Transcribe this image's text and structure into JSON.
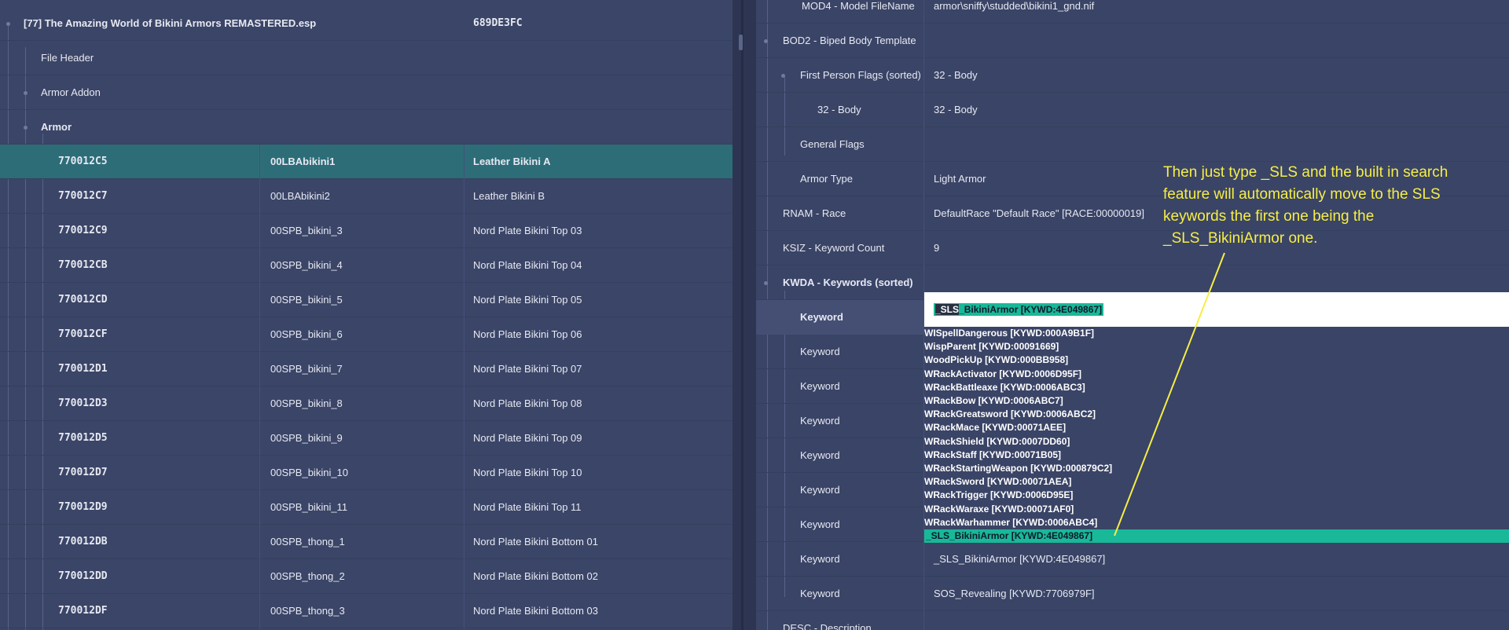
{
  "left_panel": {
    "plugin": {
      "label": "[77] The Amazing World of Bikini Armors REMASTERED.esp",
      "formid_prefix": "689DE3FC"
    },
    "groups": [
      {
        "label": "File Header"
      },
      {
        "label": "Armor Addon"
      },
      {
        "label": "Armor"
      }
    ],
    "records": [
      {
        "formid": "770012C5",
        "editor_id": "00LBAbikini1",
        "name": "Leather Bikini A",
        "selected": true
      },
      {
        "formid": "770012C7",
        "editor_id": "00LBAbikini2",
        "name": "Leather Bikini B"
      },
      {
        "formid": "770012C9",
        "editor_id": "00SPB_bikini_3",
        "name": "Nord Plate Bikini Top 03"
      },
      {
        "formid": "770012CB",
        "editor_id": "00SPB_bikini_4",
        "name": "Nord Plate Bikini Top 04"
      },
      {
        "formid": "770012CD",
        "editor_id": "00SPB_bikini_5",
        "name": "Nord Plate Bikini Top 05"
      },
      {
        "formid": "770012CF",
        "editor_id": "00SPB_bikini_6",
        "name": "Nord Plate Bikini Top 06"
      },
      {
        "formid": "770012D1",
        "editor_id": "00SPB_bikini_7",
        "name": "Nord Plate Bikini Top 07"
      },
      {
        "formid": "770012D3",
        "editor_id": "00SPB_bikini_8",
        "name": "Nord Plate Bikini Top 08"
      },
      {
        "formid": "770012D5",
        "editor_id": "00SPB_bikini_9",
        "name": "Nord Plate Bikini Top 09"
      },
      {
        "formid": "770012D7",
        "editor_id": "00SPB_bikini_10",
        "name": "Nord Plate Bikini Top 10"
      },
      {
        "formid": "770012D9",
        "editor_id": "00SPB_bikini_11",
        "name": "Nord Plate Bikini Top 11"
      },
      {
        "formid": "770012DB",
        "editor_id": "00SPB_thong_1",
        "name": "Nord Plate Bikini Bottom 01"
      },
      {
        "formid": "770012DD",
        "editor_id": "00SPB_thong_2",
        "name": "Nord Plate Bikini Bottom 02"
      },
      {
        "formid": "770012DF",
        "editor_id": "00SPB_thong_3",
        "name": "Nord Plate Bikini Bottom 03"
      }
    ]
  },
  "right_panel": {
    "rows": [
      {
        "label": "MOD4 - Model FileName",
        "value": "armor\\sniffy\\studded\\bikini1_gnd.nif"
      },
      {
        "label": "BOD2 - Biped Body Template",
        "value": ""
      },
      {
        "label": "First Person Flags (sorted)",
        "value": "32 - Body"
      },
      {
        "label": "32 - Body",
        "value": "32 - Body"
      },
      {
        "label": "General Flags",
        "value": ""
      },
      {
        "label": "Armor Type",
        "value": "Light Armor"
      },
      {
        "label": "RNAM - Race",
        "value": "DefaultRace \"Default Race\" [RACE:00000019]"
      },
      {
        "label": "KSIZ - Keyword Count",
        "value": "9"
      },
      {
        "label": "KWDA - Keywords (sorted)",
        "value": ""
      },
      {
        "label": "Keyword",
        "value": ""
      },
      {
        "label": "Keyword",
        "value": ""
      },
      {
        "label": "Keyword",
        "value": ""
      },
      {
        "label": "Keyword",
        "value": ""
      },
      {
        "label": "Keyword",
        "value": ""
      },
      {
        "label": "Keyword",
        "value": ""
      },
      {
        "label": "Keyword",
        "value": ""
      },
      {
        "label": "Keyword",
        "value": "_SLS_BikiniArmor [KYWD:4E049867]"
      },
      {
        "label": "Keyword",
        "value": "SOS_Revealing [KYWD:7706979F]"
      },
      {
        "label": "DESC - Description",
        "value": ""
      }
    ],
    "edit": {
      "typed": "_SLS",
      "completion": "_BikiniArmor [KYWD:4E049867]"
    },
    "dropdown_items": [
      "WISpellDangerous [KYWD:000A9B1F]",
      "WispParent [KYWD:00091669]",
      "WoodPickUp [KYWD:000BB958]",
      "WRackActivator [KYWD:0006D95F]",
      "WRackBattleaxe [KYWD:0006ABC3]",
      "WRackBow [KYWD:0006ABC7]",
      "WRackGreatsword [KYWD:0006ABC2]",
      "WRackMace [KYWD:00071AEE]",
      "WRackShield [KYWD:0007DD60]",
      "WRackStaff [KYWD:00071B05]",
      "WRackStartingWeapon [KYWD:000879C2]",
      "WRackSword [KYWD:00071AEA]",
      "WRackTrigger [KYWD:0006D95E]",
      "WRackWaraxe [KYWD:00071AF0]",
      "WRackWarhammer [KYWD:0006ABC4]",
      "_SLS_BikiniArmor [KYWD:4E049867]"
    ]
  },
  "annotation": {
    "text": "Then just type _SLS and the built in search feature will automatically move to the SLS keywords the first one being the _SLS_BikiniArmor one.",
    "color": "#f6ee45"
  },
  "colors": {
    "selected_row": "#2d6d78",
    "highlight": "#19b898",
    "background": "#3a4466"
  }
}
